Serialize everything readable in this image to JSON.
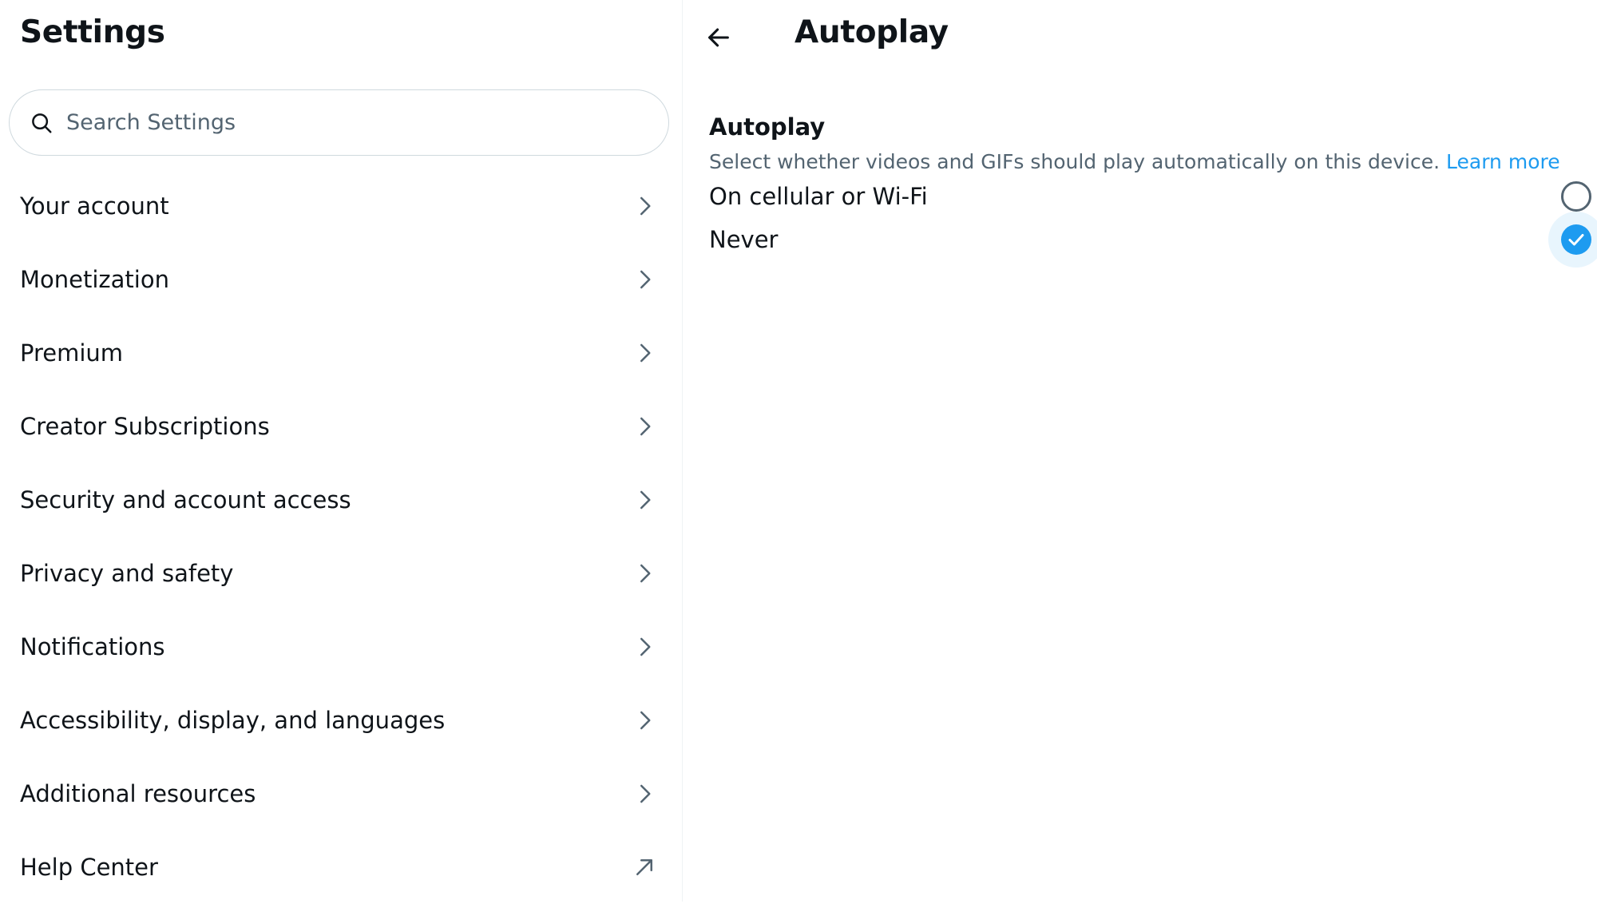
{
  "settings": {
    "title": "Settings",
    "search": {
      "placeholder": "Search Settings",
      "value": ""
    },
    "items": [
      {
        "label": "Your account",
        "icon": "chevron-right-icon"
      },
      {
        "label": "Monetization",
        "icon": "chevron-right-icon"
      },
      {
        "label": "Premium",
        "icon": "chevron-right-icon"
      },
      {
        "label": "Creator Subscriptions",
        "icon": "chevron-right-icon"
      },
      {
        "label": "Security and account access",
        "icon": "chevron-right-icon"
      },
      {
        "label": "Privacy and safety",
        "icon": "chevron-right-icon"
      },
      {
        "label": "Notifications",
        "icon": "chevron-right-icon"
      },
      {
        "label": "Accessibility, display, and languages",
        "icon": "chevron-right-icon"
      },
      {
        "label": "Additional resources",
        "icon": "chevron-right-icon"
      },
      {
        "label": "Help Center",
        "icon": "external-link-icon"
      }
    ]
  },
  "detail": {
    "back_icon": "arrow-left-icon",
    "title": "Autoplay",
    "section": {
      "heading": "Autoplay",
      "description": "Select whether videos and GIFs should play automatically on this device.",
      "learn_more": "Learn more"
    },
    "options": [
      {
        "label": "On cellular or Wi-Fi",
        "selected": false
      },
      {
        "label": "Never",
        "selected": true
      }
    ]
  },
  "colors": {
    "text_primary": "#0f1419",
    "text_secondary": "#536471",
    "accent": "#1d9bf0",
    "border": "#cfd9de"
  }
}
